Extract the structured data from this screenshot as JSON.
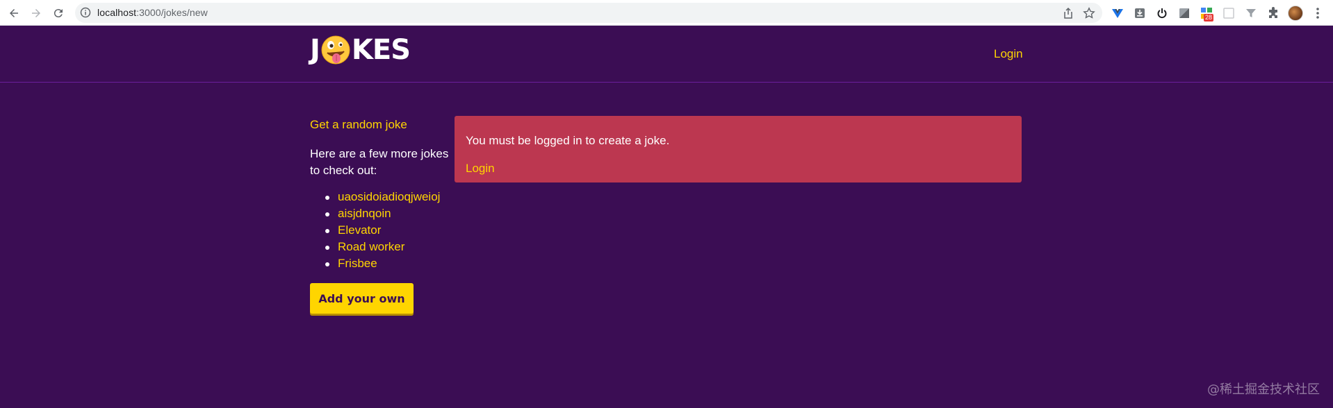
{
  "browser": {
    "url_host": "localhost",
    "url_path": ":3000/jokes/new",
    "extension_badge": "28"
  },
  "header": {
    "logo_letter_1": "J",
    "logo_letters_2": "KES",
    "login_label": "Login"
  },
  "sidebar": {
    "random_joke_label": "Get a random joke",
    "more_jokes_text": "Here are a few more jokes to check out:",
    "jokes": [
      "uaosidoiadioqjweioj",
      "aisjdnqoin",
      "Elevator",
      "Road worker",
      "Frisbee"
    ],
    "add_button_label": "Add your own"
  },
  "error": {
    "message": "You must be logged in to create a joke.",
    "login_label": "Login"
  },
  "watermark": "@稀土掘金技术社区",
  "colors": {
    "background": "#3b0d54",
    "accent": "#ffd500",
    "error_bg": "#bc3750"
  }
}
